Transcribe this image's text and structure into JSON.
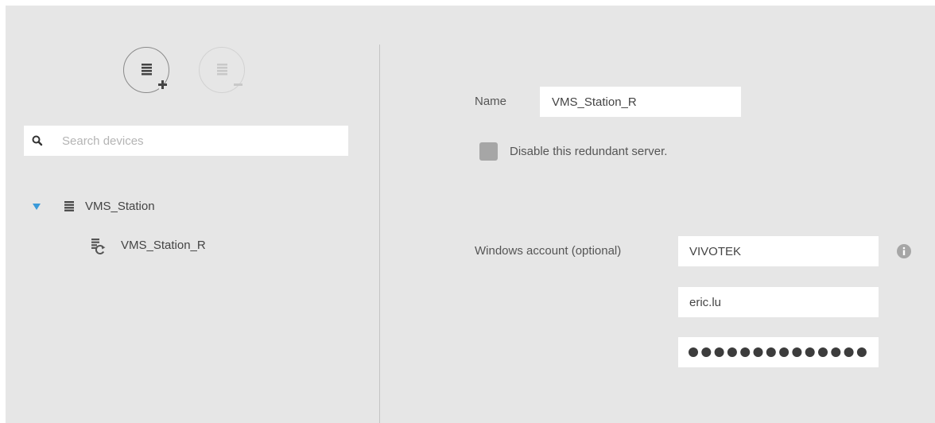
{
  "device_actions": {
    "add_icon": "add-server-icon",
    "remove_icon": "remove-server-icon"
  },
  "search": {
    "placeholder": "Search devices",
    "icon": "search-icon"
  },
  "tree": {
    "root": {
      "label": "VMS_Station",
      "expanded": true,
      "icon": "server-icon",
      "toggle_color": "#3a9ad9"
    },
    "children": [
      {
        "label": "VMS_Station_R",
        "icon": "redundant-server-icon"
      }
    ]
  },
  "form": {
    "name_label": "Name",
    "name_value": "VMS_Station_R",
    "disable_label": "Disable this redundant server.",
    "disable_checked": false,
    "windows_account_label": "Windows account (optional)",
    "domain_value": "VIVOTEK",
    "username_value": "eric.lu",
    "password_dot_count": 14,
    "info_icon": "info-icon"
  }
}
